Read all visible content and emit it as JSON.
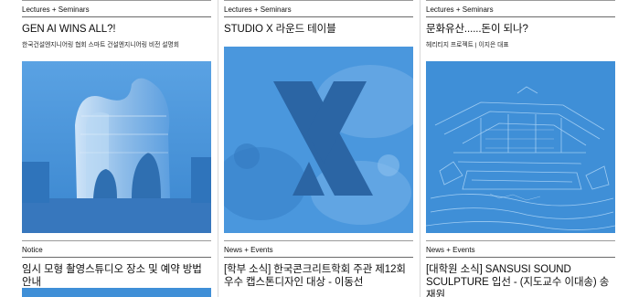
{
  "cards": [
    {
      "category": "Lectures + Seminars",
      "title": "GEN AI WINS ALL?!",
      "subtitle": "한국건설엔지니어링 협회 스마트 건설엔지니어링 비전 설명회",
      "image": "ai-generated-architecture-building-photo"
    },
    {
      "category": "Lectures + Seminars",
      "title": "STUDIO X 라운드 테이블",
      "subtitle": "",
      "image": "studio-x-logo-over-crowd-photo"
    },
    {
      "category": "Lectures + Seminars",
      "title": "문화유산......돈이 되나?",
      "subtitle": "헤리티지 프로젝트 | 이지은 대표",
      "image": "heritage-palace-edge-outline-image"
    },
    {
      "category": "Notice",
      "title": "임시 모형 촬영스튜디오 장소 및 예약 방법 안내",
      "subtitle": "",
      "image": "notice-thumbnail"
    },
    {
      "category": "News + Events",
      "title": "[학부 소식] 한국콘크리트학회 주관 제12회 우수 캡스톤디자인 대상 - 이동선",
      "subtitle": "",
      "image": ""
    },
    {
      "category": "News + Events",
      "title": "[대학원 소식] SANSUSI SOUND SCULPTURE 입선 - (지도교수 이대송) 송재원",
      "subtitle": "",
      "image": ""
    }
  ],
  "colors": {
    "thumb_blue": "#3f8fd7",
    "thumb_light": "#9cc8ef",
    "thumb_dark": "#2a6fb3",
    "text": "#111111",
    "rule": "#6a6a6a"
  }
}
